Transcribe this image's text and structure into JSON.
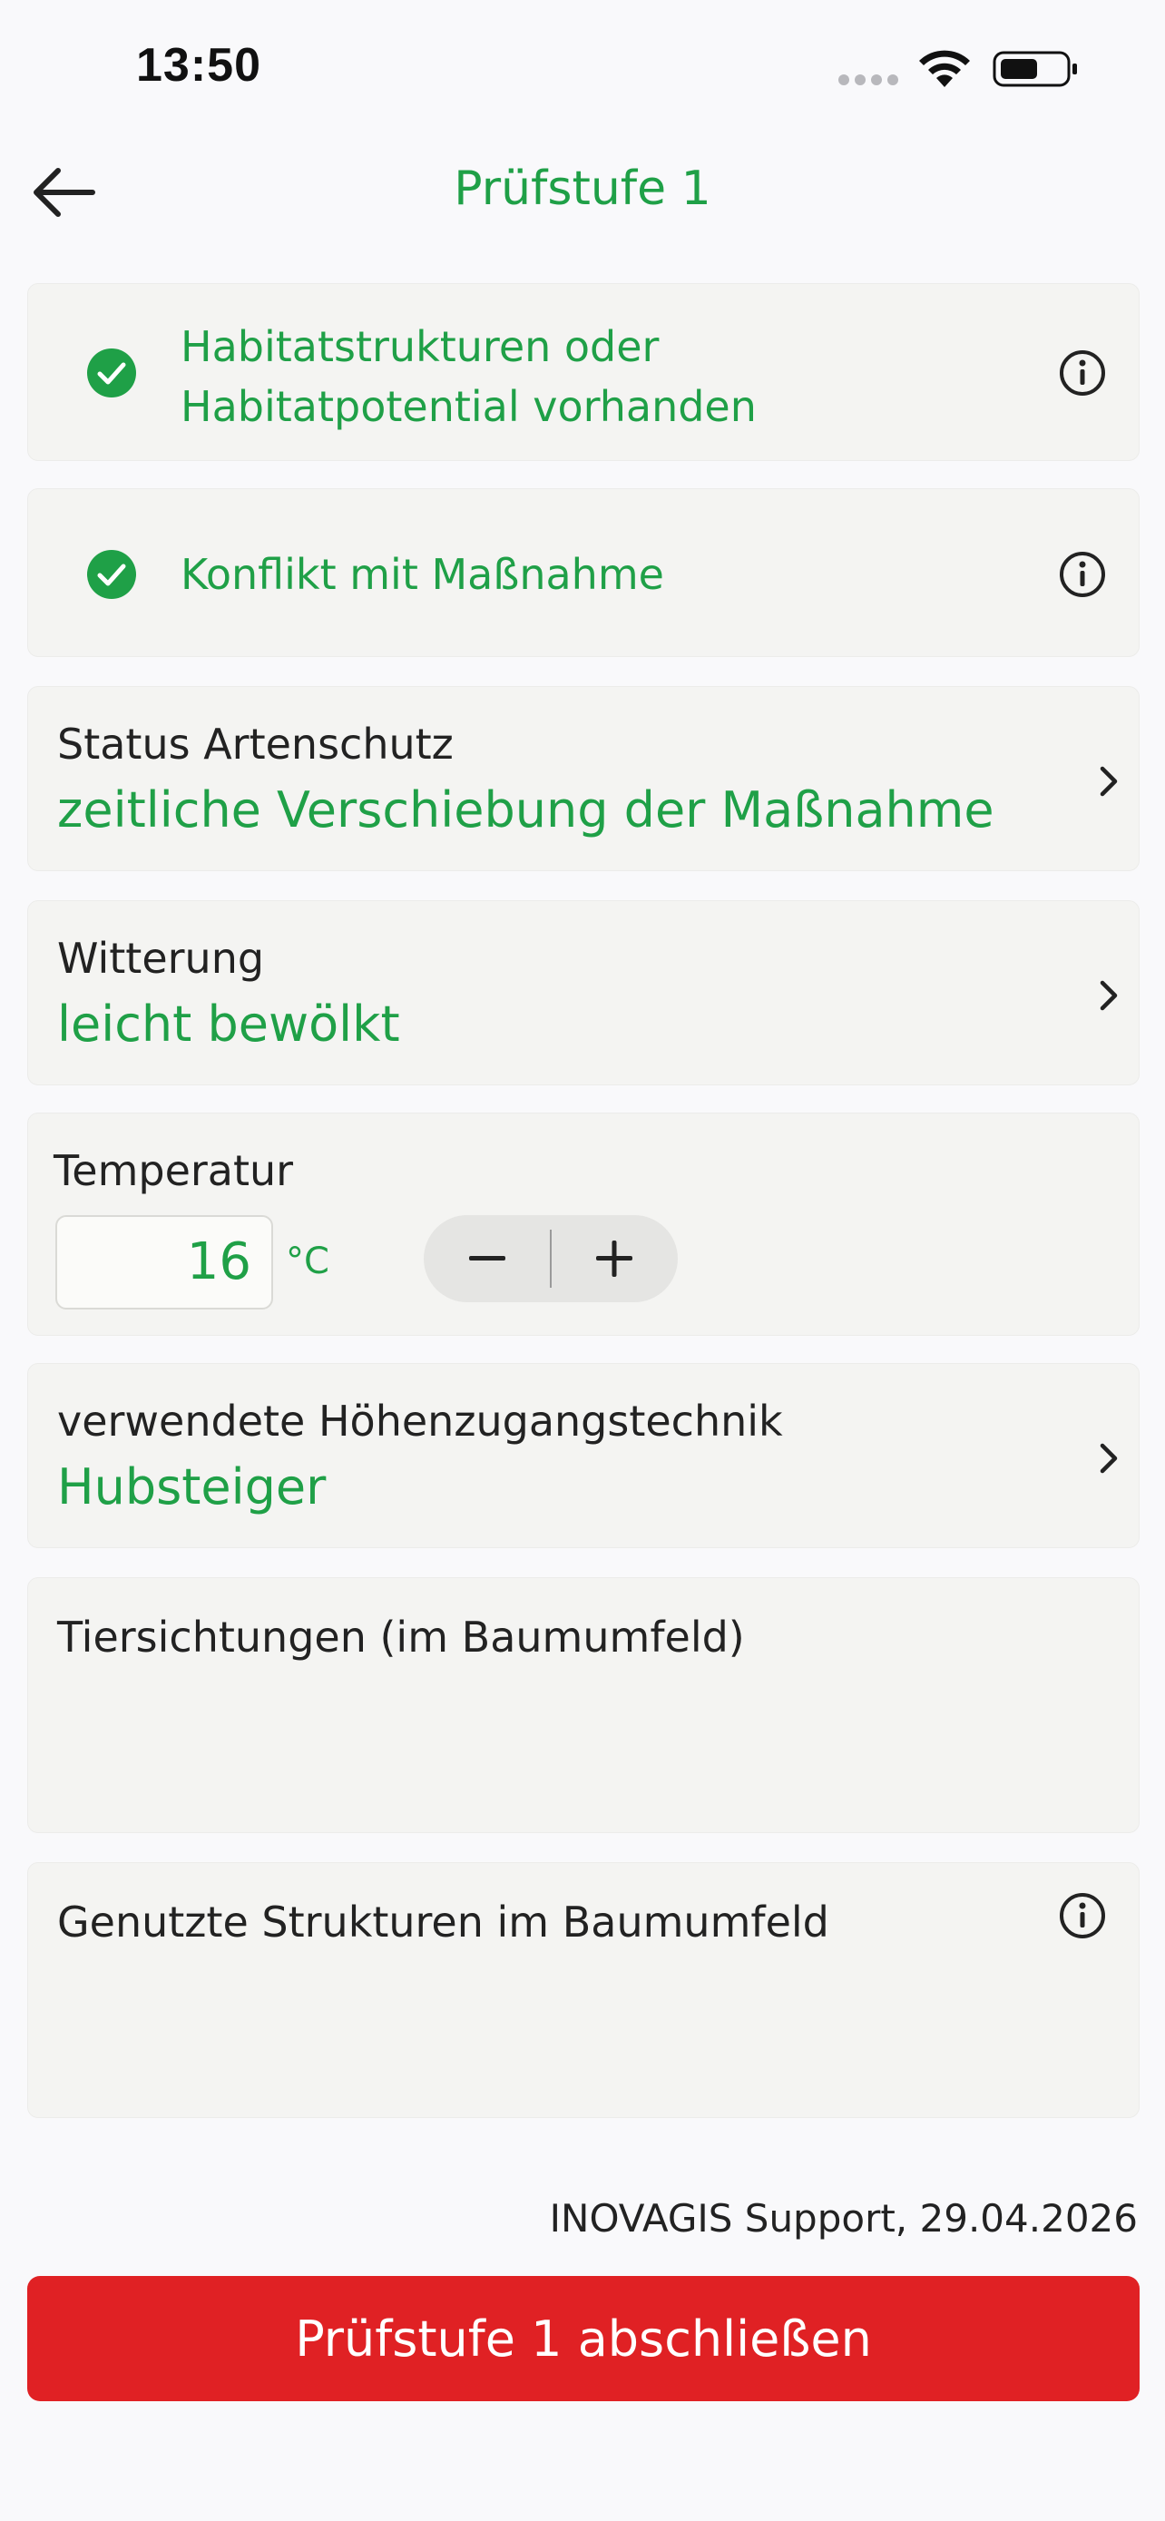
{
  "status_bar": {
    "time": "13:50"
  },
  "header": {
    "title": "Prüfstufe 1"
  },
  "checks": [
    {
      "line1": "Habitatstrukturen oder",
      "line2": "Habitatpotential vorhanden"
    },
    {
      "line1": "Konflikt mit Maßnahme"
    }
  ],
  "status_artenschutz": {
    "label": "Status Artenschutz",
    "value": "zeitliche Verschiebung der Maßnahme"
  },
  "witterung": {
    "label": "Witterung",
    "value": "leicht bewölkt"
  },
  "temperatur": {
    "label": "Temperatur",
    "value": "16",
    "unit": "°C"
  },
  "hoehenzugang": {
    "label": "verwendete Höhenzugangstechnik",
    "value": "Hubsteiger"
  },
  "tiersichtungen": {
    "label": "Tiersichtungen (im Baumumfeld)"
  },
  "strukturen": {
    "label": "Genutzte Strukturen im Baumumfeld"
  },
  "footer": {
    "note": "INOVAGIS Support, 29.04.2026",
    "button_label": "Prüfstufe 1 abschließen"
  },
  "colors": {
    "accent": "#1fa047",
    "cta": "#e02124",
    "card": "#f4f4f2"
  }
}
